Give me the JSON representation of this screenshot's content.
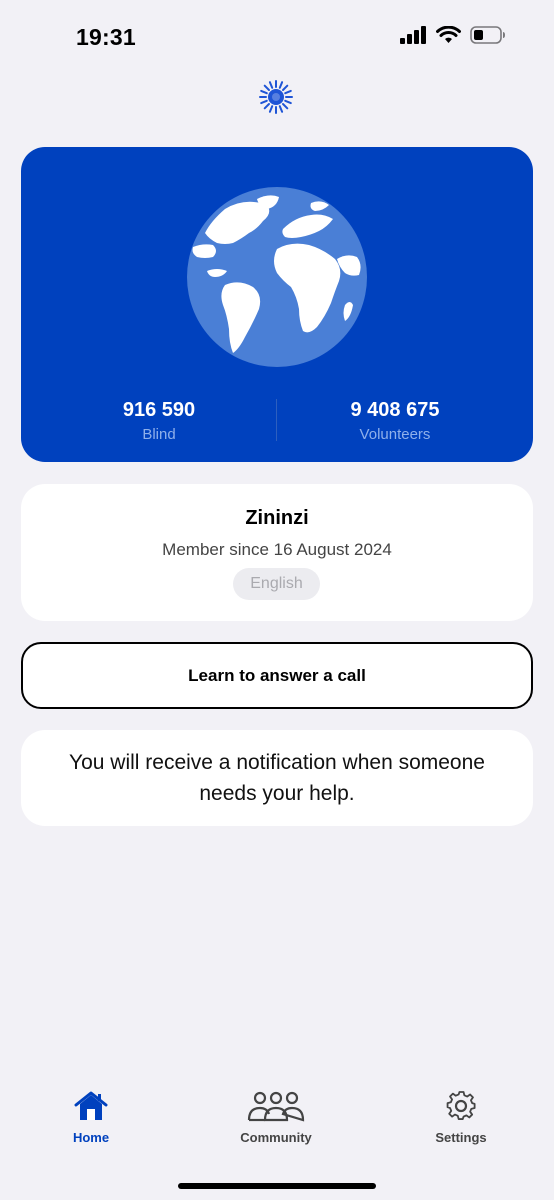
{
  "status_bar": {
    "time": "19:31",
    "icons": [
      "signal-icon",
      "wifi-icon",
      "battery-icon"
    ]
  },
  "app_logo": "sun-logo",
  "stats": {
    "blind_count": "916 590",
    "blind_label": "Blind",
    "volunteers_count": "9 408 675",
    "volunteers_label": "Volunteers"
  },
  "profile": {
    "name": "Zininzi",
    "member_since": "Member since 16 August 2024",
    "language": "English"
  },
  "learn_button": {
    "label": "Learn to answer a call"
  },
  "notice": {
    "text": "You will receive a notification when someone needs your help."
  },
  "tabs": [
    {
      "label": "Home",
      "icon": "home-icon",
      "active": true
    },
    {
      "label": "Community",
      "icon": "people-icon",
      "active": false
    },
    {
      "label": "Settings",
      "icon": "gear-icon",
      "active": false
    }
  ],
  "colors": {
    "accent": "#0041be",
    "background": "#f2f1f6",
    "card": "#ffffff"
  }
}
